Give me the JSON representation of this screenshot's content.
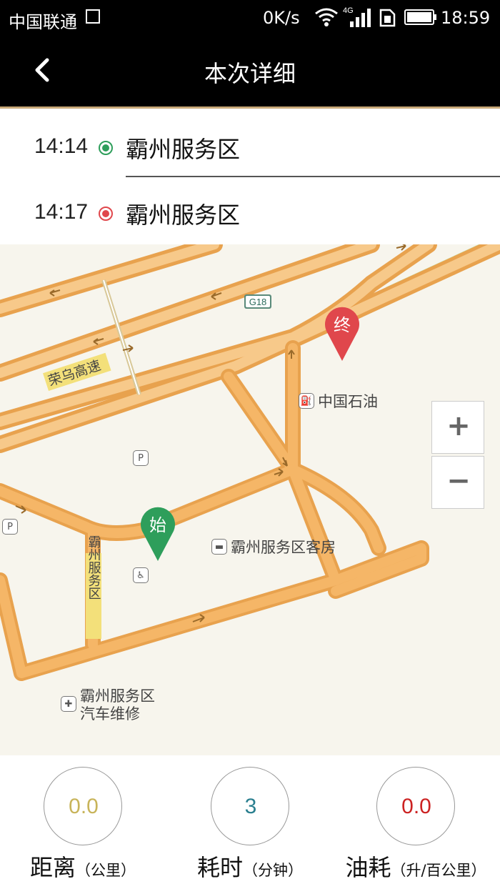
{
  "status_bar": {
    "carrier": "中国联通",
    "network_speed": "0K/s",
    "network_type": "4G",
    "time": "18:59"
  },
  "header": {
    "title": "本次详细",
    "back_icon": "chevron-left-icon"
  },
  "route": {
    "start": {
      "time": "14:14",
      "place": "霸州服务区",
      "dot_color": "#2e9e5b"
    },
    "end": {
      "time": "14:17",
      "place": "霸州服务区",
      "dot_color": "#e0474c"
    }
  },
  "map": {
    "road_labels": {
      "highway_shield": "G18",
      "expressway": "荣乌高速",
      "service_road": "霸州服务区"
    },
    "markers": {
      "start_label": "始",
      "end_label": "终",
      "start_color": "#2e9e5b",
      "end_color": "#e0474c"
    },
    "pois": {
      "gas_station": "中国石油",
      "hotel": "霸州服务区客房",
      "repair_line1": "霸州服务区",
      "repair_line2": "汽车维修"
    },
    "zoom": {
      "in": "+",
      "out": "−"
    }
  },
  "stats": {
    "distance": {
      "value": "0.0",
      "label": "距离",
      "unit": "（公里）",
      "color": "#c8b45a"
    },
    "duration": {
      "value": "3",
      "label": "耗时",
      "unit": "（分钟）",
      "color": "#2a7f8f"
    },
    "fuel": {
      "value": "0.0",
      "label": "油耗",
      "unit": "（升/百公里）",
      "color": "#cc2222"
    }
  }
}
